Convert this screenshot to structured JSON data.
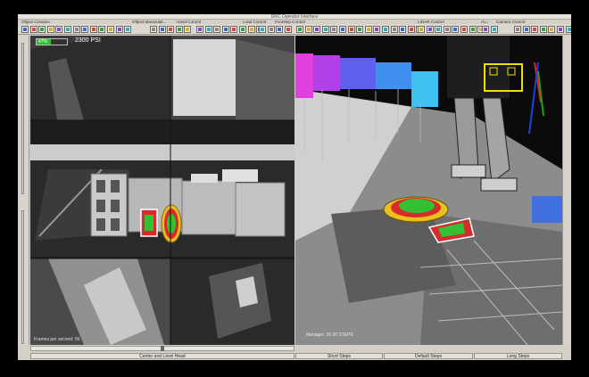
{
  "window": {
    "title": "DRC Operator Interface"
  },
  "menu_groups": [
    "Object Creation",
    "Object Manipulat...",
    "Hand Control",
    "Load Control",
    "Footstep Control",
    "LIDAR Control",
    "Au...",
    "Camera Control"
  ],
  "camera": {
    "pressure_fraction": 0.47,
    "pressure_label": "47%",
    "psi_label": "2300 PSI",
    "fps_label": "Frames per second: 56"
  },
  "view3d": {
    "overlay_text": "Manager: 20 20  STEPS"
  },
  "bottom": {
    "slider_value": 0.5,
    "buttons": [
      "Center and Level Head",
      "Short Steps",
      "Default Steps",
      "Long Steps"
    ]
  },
  "colors": {
    "accent_green": "#30c030",
    "step_red": "#d82c2c",
    "step_yellow": "#e8c020"
  }
}
